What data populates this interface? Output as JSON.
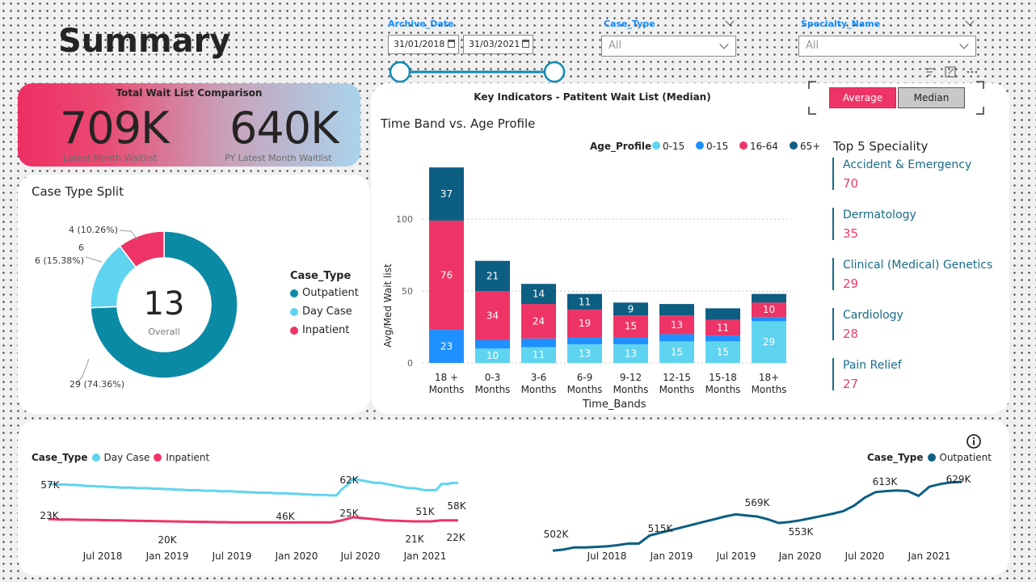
{
  "page": {
    "title": "Summary"
  },
  "filters": {
    "archive_date": {
      "label": "Archive_Date",
      "start": "31/01/2018",
      "end": "31/03/2021"
    },
    "case_type": {
      "label": "Case_Type",
      "value": "All"
    },
    "specialty_name": {
      "label": "Specialty_Name",
      "value": "All"
    }
  },
  "kpi": {
    "title": "Total Wait List Comparison",
    "latest_value": "709K",
    "latest_label": "Latest Month Waitlist",
    "py_value": "640K",
    "py_label": "PY Latest Month Waitlist"
  },
  "toggle": {
    "average_label": "Average",
    "median_label": "Median",
    "selected": "Average"
  },
  "icons": {
    "filter": "filter-icon",
    "focus": "focus-mode-icon",
    "more": "more-options-icon",
    "info": "info-icon",
    "calendar": "calendar-icon"
  },
  "colors": {
    "teal_dark": "#0d5f82",
    "teal": "#0b8aa6",
    "cyan": "#5fd4f0",
    "blue": "#1e90ff",
    "pink": "#ee3466",
    "grey_btn": "#c8c8c8"
  },
  "top5": {
    "title": "Top 5 Speciality",
    "items": [
      {
        "name": "Accident & Emergency",
        "value": "70"
      },
      {
        "name": "Dermatology",
        "value": "35"
      },
      {
        "name": "Clinical (Medical) Genetics",
        "value": "29"
      },
      {
        "name": "Cardiology",
        "value": "28"
      },
      {
        "name": "Pain Relief",
        "value": "27"
      }
    ]
  },
  "chart_data": [
    {
      "id": "case-type-split",
      "type": "pie",
      "title": "Case Type Split",
      "center_value": "13",
      "center_label": "Overall",
      "legend_title": "Case_Type",
      "slices": [
        {
          "name": "Outpatient",
          "value": 29,
          "label": "29 (74.36%)",
          "color": "#0b8aa6"
        },
        {
          "name": "Day Case",
          "value": 6,
          "label": "6 (15.38%)",
          "color": "#5fd4f0"
        },
        {
          "name": "Inpatient",
          "value": 4,
          "label": "4 (10.26%)",
          "color": "#ee3466"
        }
      ]
    },
    {
      "id": "time-band-age",
      "type": "bar",
      "stacked": true,
      "header": "Key Indicators - Patitent Wait List (Median)",
      "title": "Time Band vs. Age Profile",
      "xlabel": "Time_Bands",
      "ylabel": "Avg/Med Wait list",
      "ylim": [
        0,
        140
      ],
      "yticks": [
        0,
        50,
        100
      ],
      "legend_title": "Age_Profile",
      "grid": true,
      "categories": [
        "18 + Months",
        "0-3 Months",
        "3-6 Months",
        "6-9 Months",
        "9-12 Months",
        "12-15 Months",
        "15-18 Months",
        "18+ Months"
      ],
      "series": [
        {
          "name": "0-15",
          "color": "#5fd4f0",
          "values": [
            0,
            10,
            11,
            13,
            13,
            15,
            15,
            29
          ],
          "labels": [
            "",
            "10",
            "11",
            "13",
            "13",
            "15",
            "15",
            "29"
          ]
        },
        {
          "name": "0-15",
          "color": "#1e90ff",
          "values": [
            23,
            6,
            6,
            5,
            5,
            5,
            4,
            3
          ],
          "labels": [
            "23",
            "",
            "",
            "",
            "",
            "",
            "",
            ""
          ]
        },
        {
          "name": "16-64",
          "color": "#ee3466",
          "values": [
            76,
            34,
            24,
            19,
            15,
            13,
            11,
            10
          ],
          "labels": [
            "76",
            "34",
            "24",
            "19",
            "15",
            "13",
            "11",
            "10"
          ]
        },
        {
          "name": "65+",
          "color": "#0d5f82",
          "values": [
            37,
            21,
            14,
            11,
            9,
            8,
            8,
            6
          ],
          "labels": [
            "37",
            "21",
            "14",
            "11",
            "9",
            "",
            "",
            ""
          ]
        }
      ]
    },
    {
      "id": "trend-daycase-inpatient",
      "type": "line",
      "legend_title": "Case_Type",
      "x_ticks": [
        "Jul 2018",
        "Jan 2019",
        "Jul 2019",
        "Jan 2020",
        "Jul 2020",
        "Jan 2021"
      ],
      "ylim": [
        0,
        70
      ],
      "series": [
        {
          "name": "Day Case",
          "color": "#5fd4f0",
          "values": [
            57,
            57,
            56.5,
            56.5,
            56,
            56,
            55.5,
            55,
            55,
            54.5,
            54.5,
            54,
            54,
            53.5,
            53.5,
            53.5,
            53,
            53,
            53,
            52.5,
            52.5,
            52,
            52,
            51.5,
            51.5,
            51,
            51,
            51,
            50.5,
            50.5,
            50.5,
            50,
            50,
            50,
            49.5,
            49.5,
            49,
            49,
            48.5,
            48.5,
            48.5,
            48,
            48,
            48,
            47.5,
            47.5,
            47,
            47,
            46.5,
            46.5,
            46.5,
            46,
            46,
            52,
            56,
            62,
            61,
            60,
            59,
            58,
            58,
            57,
            56,
            55,
            54,
            53,
            53,
            52,
            51,
            51,
            51,
            57,
            57,
            58,
            58
          ]
        },
        {
          "name": "Inpatient",
          "color": "#ee3466",
          "values": [
            23,
            23,
            22.8,
            22.8,
            22.7,
            22.6,
            22.5,
            22.5,
            22.4,
            22.3,
            22.2,
            22.1,
            22.0,
            21.9,
            21.8,
            21.7,
            21.6,
            21.5,
            21.4,
            21.3,
            21.2,
            21.1,
            21.0,
            20.9,
            20.8,
            20.7,
            20.6,
            20.5,
            20.5,
            20.4,
            20.3,
            20.2,
            20.2,
            20.1,
            20,
            20,
            20,
            20,
            20,
            20,
            20,
            20,
            20,
            20,
            20,
            20,
            20,
            20,
            20,
            20,
            20,
            20,
            21,
            22,
            23.5,
            25,
            24.5,
            24,
            23.5,
            23,
            22.5,
            22,
            21.8,
            21.6,
            21.4,
            21.2,
            21,
            21,
            21,
            21,
            21.5,
            22,
            22,
            22,
            22
          ]
        }
      ],
      "annotations": [
        "57K",
        "23K",
        "20K",
        "46K",
        "62K",
        "25K",
        "51K",
        "58K",
        "21K",
        "22K"
      ]
    },
    {
      "id": "trend-outpatient",
      "type": "line",
      "legend_title": "Case_Type",
      "x_ticks": [
        "Jul 2018",
        "Jan 2019",
        "Jul 2019",
        "Jan 2020",
        "Jul 2020",
        "Jan 2021"
      ],
      "ylim": [
        480,
        650
      ],
      "series": [
        {
          "name": "Outpatient",
          "color": "#0d5f82",
          "values": [
            502,
            504,
            508,
            508,
            509,
            510,
            512,
            515,
            515,
            530,
            535,
            540,
            545,
            550,
            555,
            560,
            565,
            569,
            567,
            565,
            560,
            553,
            555,
            558,
            562,
            566,
            570,
            575,
            585,
            600,
            610,
            612,
            613,
            612,
            603,
            620,
            625,
            628,
            629
          ]
        }
      ],
      "annotations": [
        "502K",
        "515K",
        "569K",
        "553K",
        "613K",
        "629K"
      ]
    }
  ]
}
